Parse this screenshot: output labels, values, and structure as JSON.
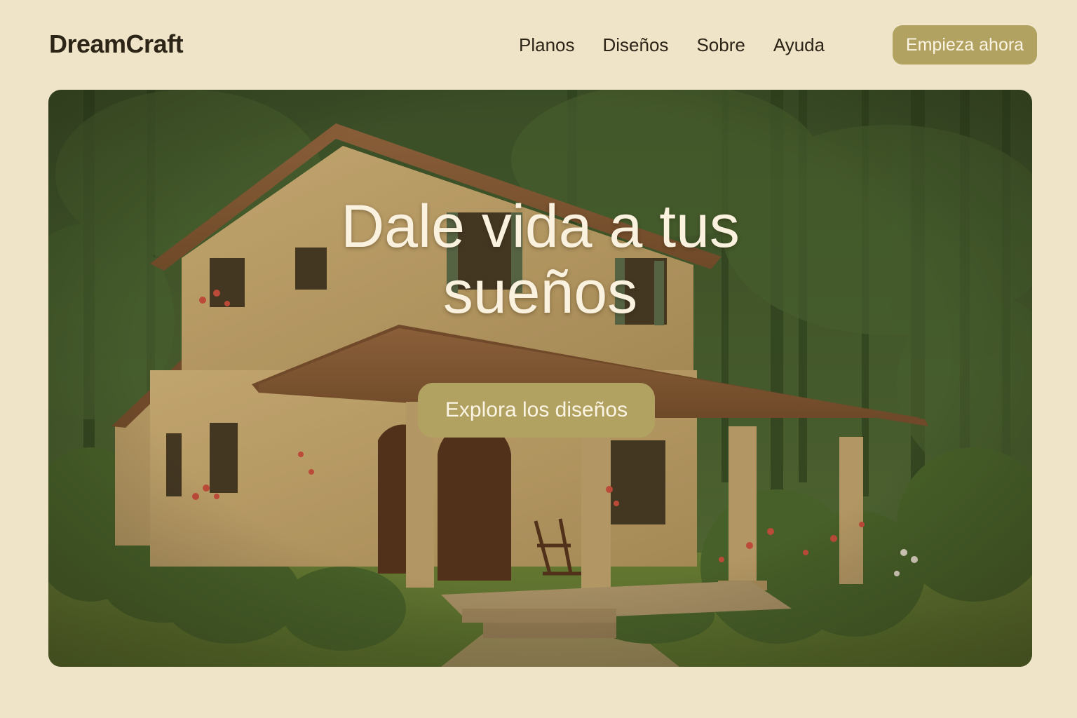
{
  "header": {
    "logo": "DreamCraft",
    "nav": [
      "Planos",
      "Diseños",
      "Sobre",
      "Ayuda"
    ],
    "cta_label": "Empieza ahora"
  },
  "hero": {
    "title_line1": "Dale vida a tus",
    "title_line2": "sueños",
    "cta_label": "Explora los diseños"
  },
  "colors": {
    "background": "#efe3c8",
    "accent": "#b1a262",
    "text_dark": "#2b2417",
    "text_light": "#fbf1df",
    "forest": "#3f5a2c"
  }
}
